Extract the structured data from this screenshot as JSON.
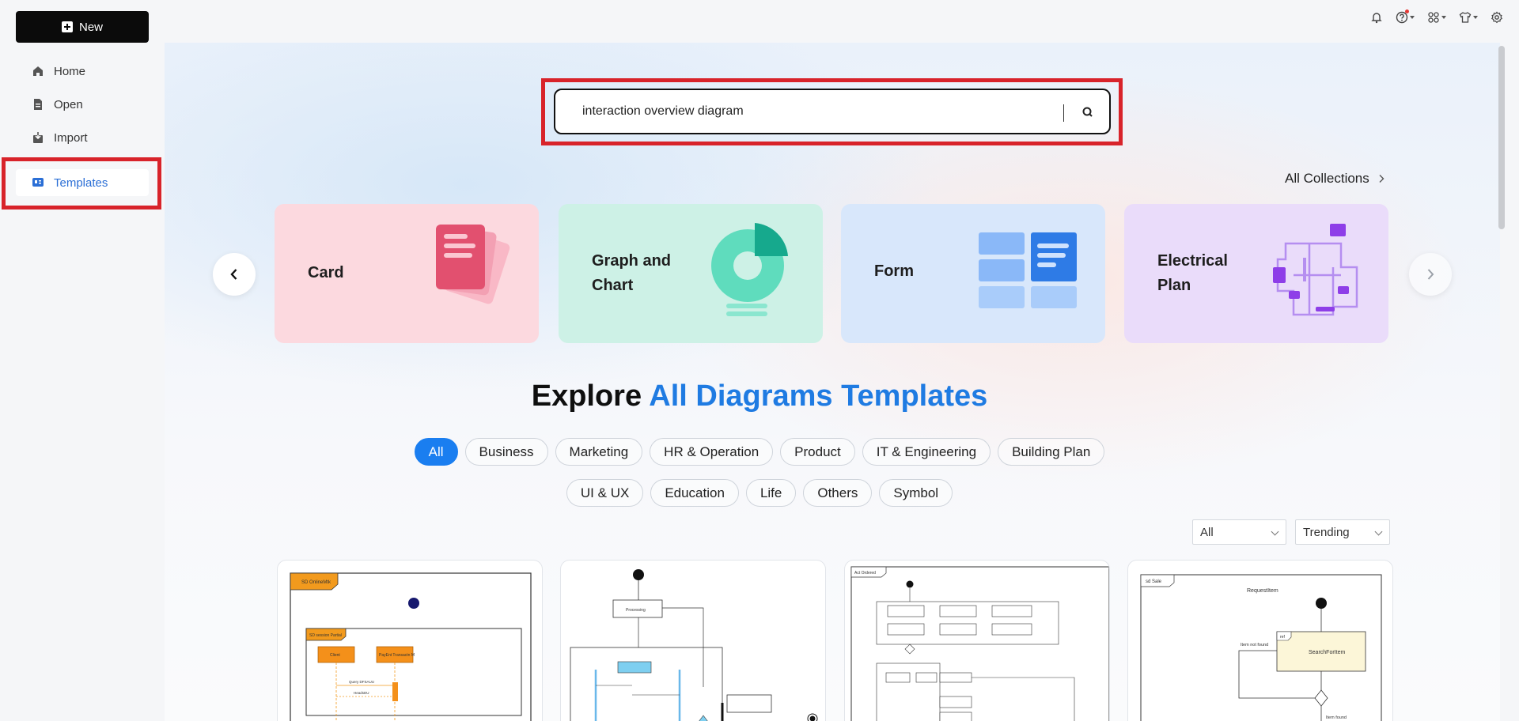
{
  "sidebar": {
    "new_label": "New",
    "items": [
      {
        "label": "Home",
        "icon": "home-icon"
      },
      {
        "label": "Open",
        "icon": "file-icon"
      },
      {
        "label": "Import",
        "icon": "import-icon"
      },
      {
        "label": "Templates",
        "icon": "templates-icon",
        "active": true
      }
    ]
  },
  "header_icons": [
    "bell-icon",
    "help-icon",
    "apps-icon",
    "shirt-icon",
    "settings-icon"
  ],
  "search": {
    "value": "interaction overview diagram"
  },
  "collections": {
    "all_label": "All Collections"
  },
  "categories": [
    {
      "label_line1": "Card",
      "label_line2": "",
      "bg": "#fcd9df"
    },
    {
      "label_line1": "Graph and",
      "label_line2": "Chart",
      "bg": "#cdf1e6"
    },
    {
      "label_line1": "Form",
      "label_line2": "",
      "bg": "#d8e7fb"
    },
    {
      "label_line1": "Electrical",
      "label_line2": "Plan",
      "bg": "#eadcfa"
    }
  ],
  "explore": {
    "prefix": "Explore",
    "highlight": "All Diagrams Templates"
  },
  "filters_row1": [
    "All",
    "Business",
    "Marketing",
    "HR & Operation",
    "Product",
    "IT & Engineering",
    "Building Plan"
  ],
  "filters_row2": [
    "UI & UX",
    "Education",
    "Life",
    "Others",
    "Symbol"
  ],
  "sort": {
    "type_value": "All",
    "order_value": "Trending"
  },
  "template_previews": {
    "card1_header": "SD OnlineMtk",
    "card1_frame": "SD session Partial",
    "card1_lifeline1": "Client",
    "card1_lifeline2": "PayEnt Transactn M",
    "card1_msg1": "Query DFSAUU",
    "card1_msg2": "HeadsDU",
    "card2_node": "Processing",
    "card3_header": "Act Ordered",
    "card4_header": "sd Sale",
    "card4_label1": "RequestItem",
    "card4_label2": "ref",
    "card4_label3": "SearchForItem",
    "card4_label4": "Item not found",
    "card4_label5": "Item found"
  },
  "colors": {
    "accent": "#1a7ef0",
    "highlight_red": "#d8232a"
  }
}
